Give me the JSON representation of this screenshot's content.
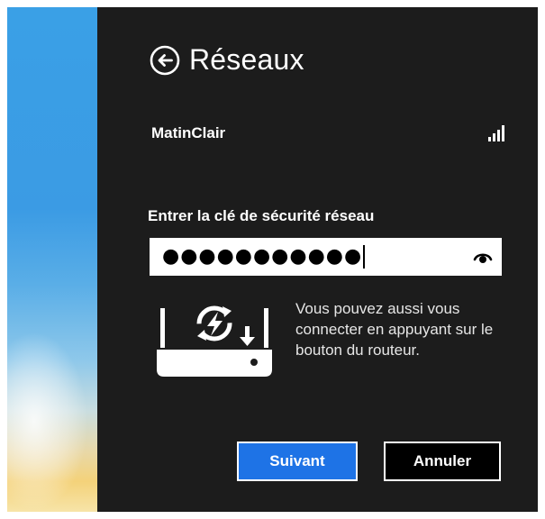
{
  "panel": {
    "title": "Réseaux",
    "back_icon": "back-arrow-circle-icon"
  },
  "network": {
    "name": "MatinClair",
    "signal_icon": "wifi-signal-bars-icon",
    "signal_bars": 4
  },
  "security": {
    "label": "Entrer la clé de sécurité réseau",
    "masked_value": "●●●●●●●●●●●",
    "reveal_icon": "eye-reveal-icon"
  },
  "wps": {
    "icon": "router-wps-icon",
    "text": "Vous pouvez aussi vous connecter en appuyant sur le bouton du routeur."
  },
  "buttons": {
    "next_label": "Suivant",
    "cancel_label": "Annuler"
  },
  "colors": {
    "panel_bg": "#1c1c1c",
    "accent": "#1e73e6",
    "desktop_blue": "#3aa0e6"
  }
}
